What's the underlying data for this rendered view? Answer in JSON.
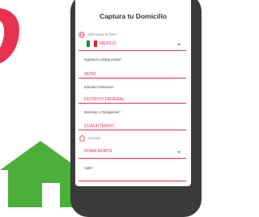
{
  "background": {
    "big_letter": "O"
  },
  "form": {
    "title": "Captura tu Domicilio",
    "country_label": "Selecciona tu País*",
    "country_value": "MEXICO",
    "postal_label": "Ingresa tu código postal*",
    "postal_value": "06700",
    "state_label": "Entidad Federativa*",
    "state_value": "DISTRITO FEDERAL",
    "municipality_label": "Municipio o Delegación*",
    "municipality_value": "CUAUHTEMOC",
    "colonia_label": "Colonia*",
    "colonia_value": "ROMA NORTE",
    "street_label": "Calle*"
  },
  "colors": {
    "accent": "#e8324f",
    "house_green": "#4caf3a",
    "phone_frame": "#3a3b3d"
  },
  "icons": [
    "globe-icon",
    "mexico-flag-icon",
    "home-icon",
    "chevron-down-icon"
  ]
}
